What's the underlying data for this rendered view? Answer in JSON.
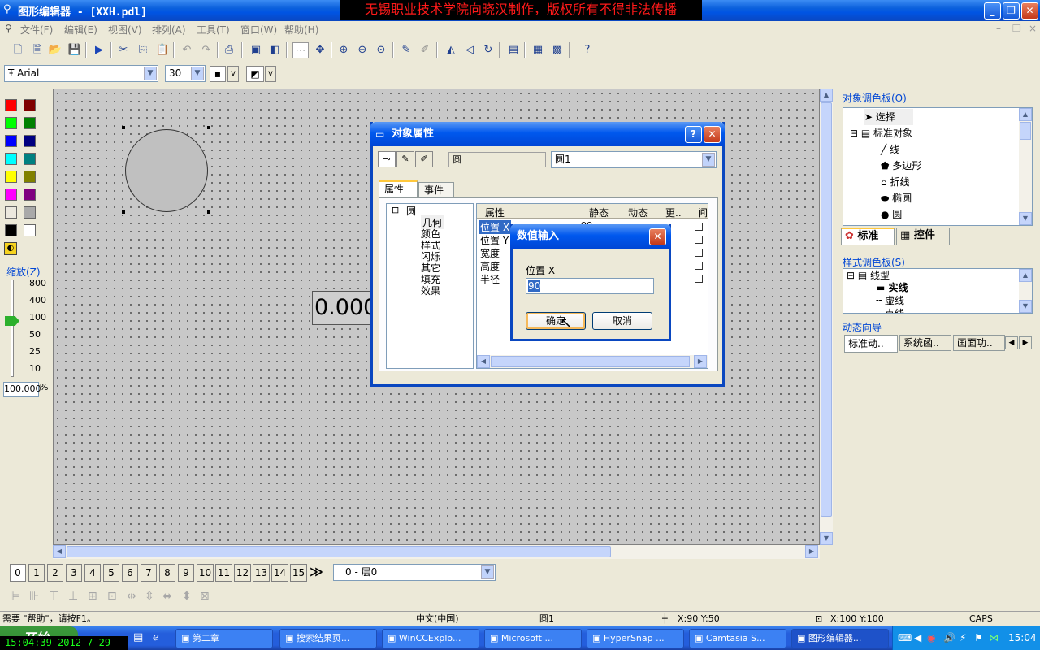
{
  "title_bar": {
    "title": "图形编辑器 - [XXH.pdl]",
    "banner": "无锡职业技术学院向晓汉制作，版权所有不得非法传播",
    "minimize": "_",
    "restore": "❐",
    "close": "✕"
  },
  "menu": {
    "items": [
      "文件(F)",
      "编辑(E)",
      "视图(V)",
      "排列(A)",
      "工具(T)",
      "窗口(W)",
      "帮助(H)"
    ]
  },
  "toolbar2": {
    "font_name": "Arial",
    "font_size": "30",
    "linestyle_btn": "v",
    "fillstyle_btn": "v"
  },
  "palette": {
    "colors": [
      [
        "#FF0000",
        "#800000"
      ],
      [
        "#00FF00",
        "#008000"
      ],
      [
        "#0000FF",
        "#000080"
      ],
      [
        "#00FFFF",
        "#008080"
      ],
      [
        "#FFFF00",
        "#808000"
      ],
      [
        "#FF00FF",
        "#800080"
      ],
      [
        "#EBE8DE",
        "#A9A9A9"
      ],
      [
        "#000000",
        "#FFFFFF"
      ]
    ]
  },
  "zoom": {
    "label": "缩放(Z)",
    "ticks": [
      "800",
      "400",
      "100",
      "50",
      "25",
      "10"
    ],
    "value": "100.000",
    "unit": "%"
  },
  "canvas": {
    "io_text": "0.000"
  },
  "object_props": {
    "title": "对象属性",
    "help_btn": "?",
    "close_btn": "✕",
    "type_value": "圆",
    "object_name": "圆1",
    "tabs": [
      "属性",
      "事件"
    ],
    "tree_root": "圆",
    "tree_items": [
      "几何",
      "颜色",
      "样式",
      "闪烁",
      "其它",
      "填充",
      "效果"
    ],
    "table_headers": [
      "属性",
      "静态",
      "动态",
      "更..",
      "间"
    ],
    "rows": [
      "位置 X",
      "位置 Y",
      "宽度",
      "高度",
      "半径"
    ],
    "first_static": "90"
  },
  "value_input": {
    "title": "数值输入",
    "close_btn": "✕",
    "label": "位置 X",
    "value": "90",
    "ok": "确定",
    "cancel": "取消"
  },
  "object_palette": {
    "label": "对象调色板(O)",
    "tree": [
      {
        "text": "选择",
        "icon": "arrow-icon"
      },
      {
        "text": "标准对象",
        "icon": "folder-icon"
      },
      {
        "text": "线",
        "icon": "line-icon"
      },
      {
        "text": "多边形",
        "icon": "polygon-icon"
      },
      {
        "text": "折线",
        "icon": "polyline-icon"
      },
      {
        "text": "椭圆",
        "icon": "ellipse-icon"
      },
      {
        "text": "圆",
        "icon": "circle-icon"
      }
    ],
    "tabs": [
      "标准",
      "控件"
    ]
  },
  "style_palette": {
    "label": "样式调色板(S)",
    "items": [
      "线型",
      "实线",
      "虚线",
      "点线"
    ]
  },
  "dynamic_wizard": {
    "label": "动态向导",
    "tabs": [
      "标准动..",
      "系统函..",
      "画面功.."
    ]
  },
  "layers": {
    "buttons": [
      "0",
      "1",
      "2",
      "3",
      "4",
      "5",
      "6",
      "7",
      "8",
      "9",
      "10",
      "11",
      "12",
      "13",
      "14",
      "15"
    ],
    "more": "≫",
    "current": "0 - 层0"
  },
  "status": {
    "help": "需要 \"帮助\"，请按F1。",
    "lang": "中文(中国)",
    "object": "圆1",
    "pos": "X:90 Y:50",
    "size": "X:100 Y:100",
    "caps": "CAPS"
  },
  "taskbar": {
    "start": "开始",
    "clock_overlay": "15:04:39 2012-7-29",
    "tasks": [
      "第二章",
      "搜索结果页...",
      "WinCCExplo...",
      "Microsoft ...",
      "HyperSnap ...",
      "Camtasia S...",
      "图形编辑器..."
    ],
    "time": "15:04"
  }
}
